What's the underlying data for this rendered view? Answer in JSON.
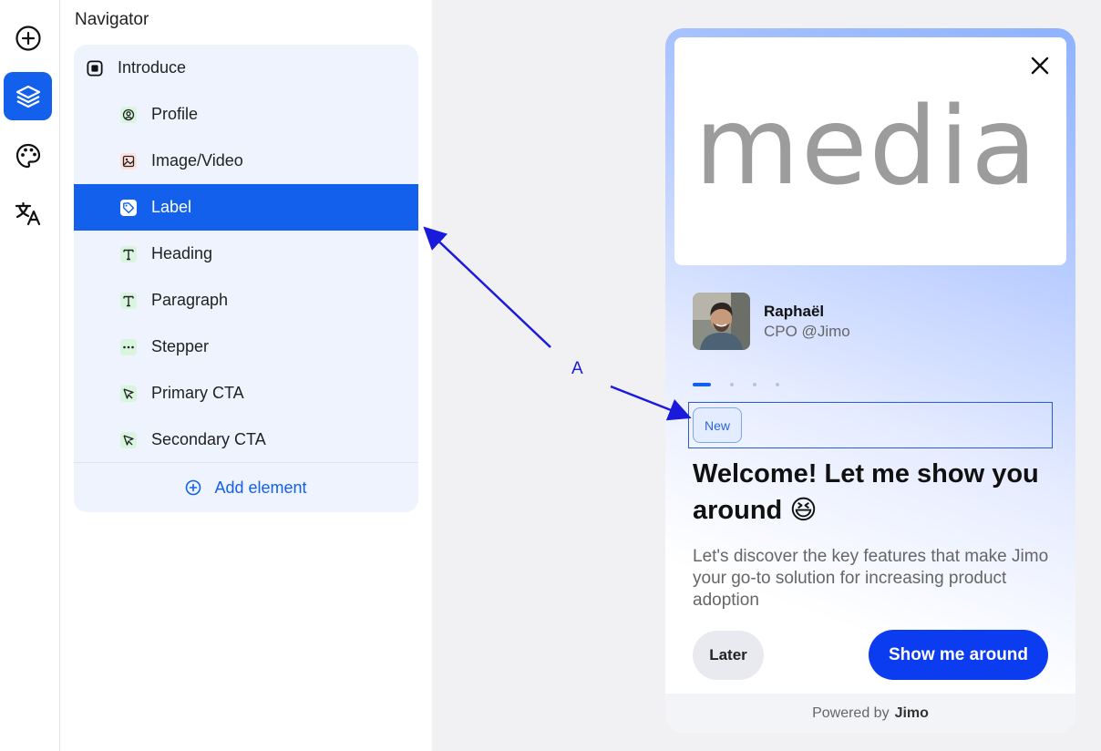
{
  "rail": {
    "items": [
      {
        "icon": "add-circle-icon",
        "active": false
      },
      {
        "icon": "layers-icon",
        "active": true
      },
      {
        "icon": "palette-icon",
        "active": false
      },
      {
        "icon": "translate-icon",
        "active": false
      }
    ]
  },
  "navigator": {
    "title": "Navigator",
    "root": {
      "label": "Introduce",
      "icon": "step-icon"
    },
    "items": [
      {
        "label": "Profile",
        "icon": "profile-icon",
        "selected": false
      },
      {
        "label": "Image/Video",
        "icon": "image-icon",
        "selected": false
      },
      {
        "label": "Label",
        "icon": "tag-icon",
        "selected": true
      },
      {
        "label": "Heading",
        "icon": "text-icon",
        "selected": false
      },
      {
        "label": "Paragraph",
        "icon": "text-icon",
        "selected": false
      },
      {
        "label": "Stepper",
        "icon": "dots-icon",
        "selected": false
      },
      {
        "label": "Primary CTA",
        "icon": "cursor-icon",
        "selected": false
      },
      {
        "label": "Secondary CTA",
        "icon": "cursor-icon",
        "selected": false
      }
    ],
    "add_element": "Add element"
  },
  "preview": {
    "media_placeholder": "media",
    "profile": {
      "name": "Raphaël",
      "role": "CPO @Jimo"
    },
    "stepper": {
      "current": 1,
      "total": 4
    },
    "label": "New",
    "heading": "Welcome! Let me show you around 😆",
    "paragraph": "Let's discover the key features that make Jimo your go-to solution for increasing product adoption",
    "secondary_cta": "Later",
    "primary_cta": "Show me around",
    "powered_by": "Powered by",
    "brand": "Jimo"
  },
  "annotation": {
    "letter": "A"
  },
  "colors": {
    "accent": "#1260eb",
    "primary_button": "#0b3cf0",
    "annotation": "#1a1adb"
  }
}
